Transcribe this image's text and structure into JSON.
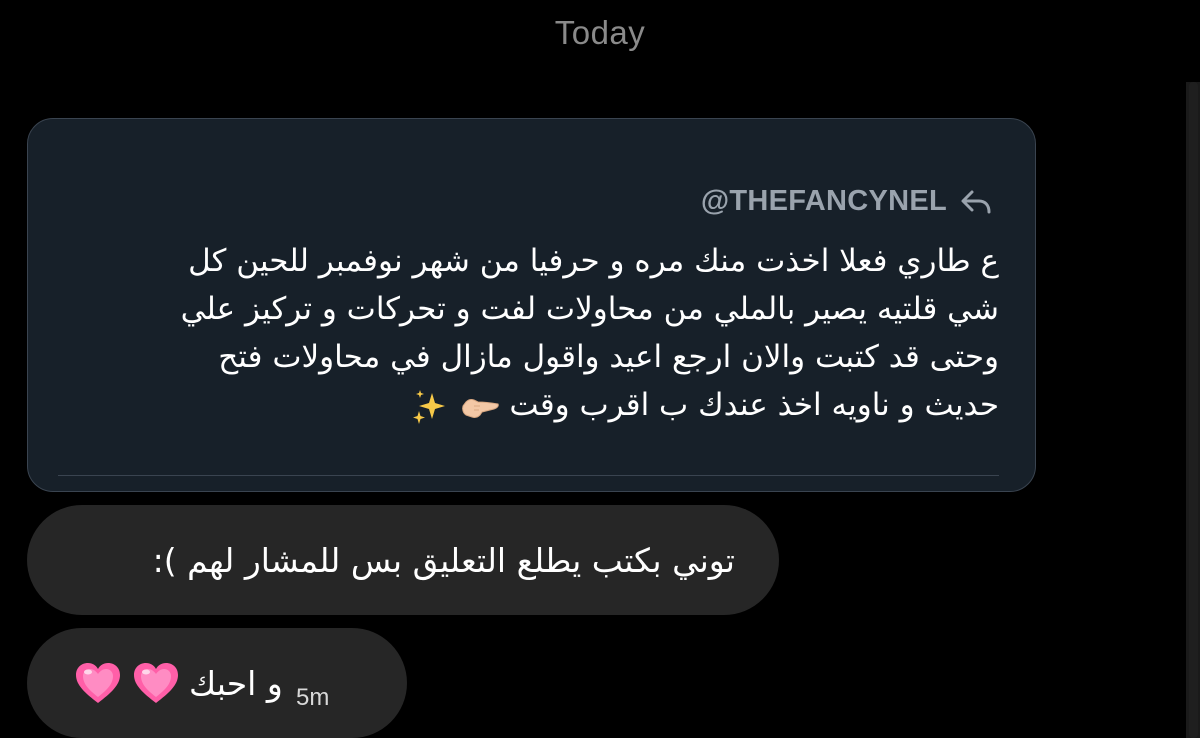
{
  "header": {
    "date_label": "Today"
  },
  "quoted_message": {
    "author": "@THEFANCYNEL",
    "lines": [
      "ع طاري فعلا اخذت منك مره و حرفيا من شهر نوفمبر للحين كل",
      "شي قلتيه يصير بالملي من محاولات لفت و تحركات و تركيز علي",
      "وحتى قد كتبت  والان ارجع اعيد واقول مازال في محاولات فتح",
      "حديث و ناويه اخذ عندك ب اقرب وقت"
    ],
    "trailing_icons": [
      "pointing-hand-icon",
      "sparkles-icon"
    ]
  },
  "messages": [
    {
      "text": "توني بكتب يطلع التعليق بس للمشار لهم ):"
    },
    {
      "text": "و احبك",
      "trailing_icons": [
        "pink-heart-icon",
        "pink-heart-icon"
      ],
      "timestamp": "5m"
    }
  ],
  "colors": {
    "background": "#000000",
    "quote_card_bg": "#172029",
    "quote_card_border": "#3a4450",
    "bubble_bg": "#262626",
    "muted_text": "#8a8a8a",
    "author_text": "#9aa3ad",
    "heart_pink": "#ff5fa8"
  }
}
